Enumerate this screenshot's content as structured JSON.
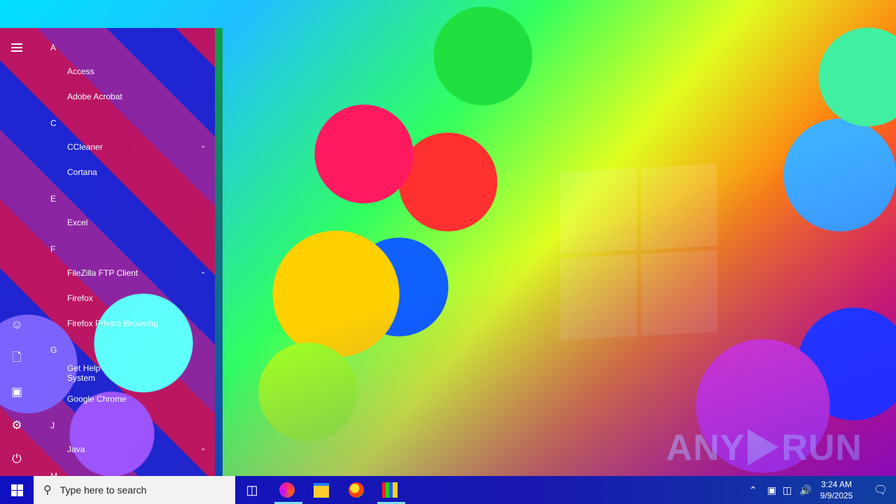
{
  "start_menu": {
    "sections": [
      {
        "letter": "A",
        "apps": [
          {
            "label": "Access"
          },
          {
            "label": "Adobe Acrobat"
          }
        ]
      },
      {
        "letter": "C",
        "apps": [
          {
            "label": "CCleaner",
            "expandable": true
          },
          {
            "label": "Cortana"
          }
        ]
      },
      {
        "letter": "E",
        "apps": [
          {
            "label": "Excel"
          }
        ]
      },
      {
        "letter": "F",
        "apps": [
          {
            "label": "FileZilla FTP Client",
            "expandable": true
          },
          {
            "label": "Firefox"
          },
          {
            "label": "Firefox Private Browsing"
          }
        ]
      },
      {
        "letter": "G",
        "apps": [
          {
            "label": "Get Help",
            "sublabel": "System"
          },
          {
            "label": "Google Chrome"
          }
        ]
      },
      {
        "letter": "J",
        "apps": [
          {
            "label": "Java",
            "expandable": true
          }
        ]
      },
      {
        "letter": "M",
        "apps": []
      }
    ],
    "rail_icons": [
      "hamburger-menu-icon",
      "user-icon",
      "document-icon",
      "pictures-icon",
      "settings-icon",
      "power-icon"
    ]
  },
  "taskbar": {
    "search_placeholder": "Type here to search",
    "pinned": [
      "task-view-icon",
      "edge-icon",
      "file-explorer-icon",
      "firefox-icon",
      "winrar-icon"
    ],
    "clock_time": "3:24 AM",
    "clock_date": "9/9/2025"
  },
  "watermark": {
    "text_left": "ANY",
    "text_right": "RUN"
  },
  "colors": {
    "taskbar": "#1818b0",
    "search_bg": "#f2f2f2"
  }
}
